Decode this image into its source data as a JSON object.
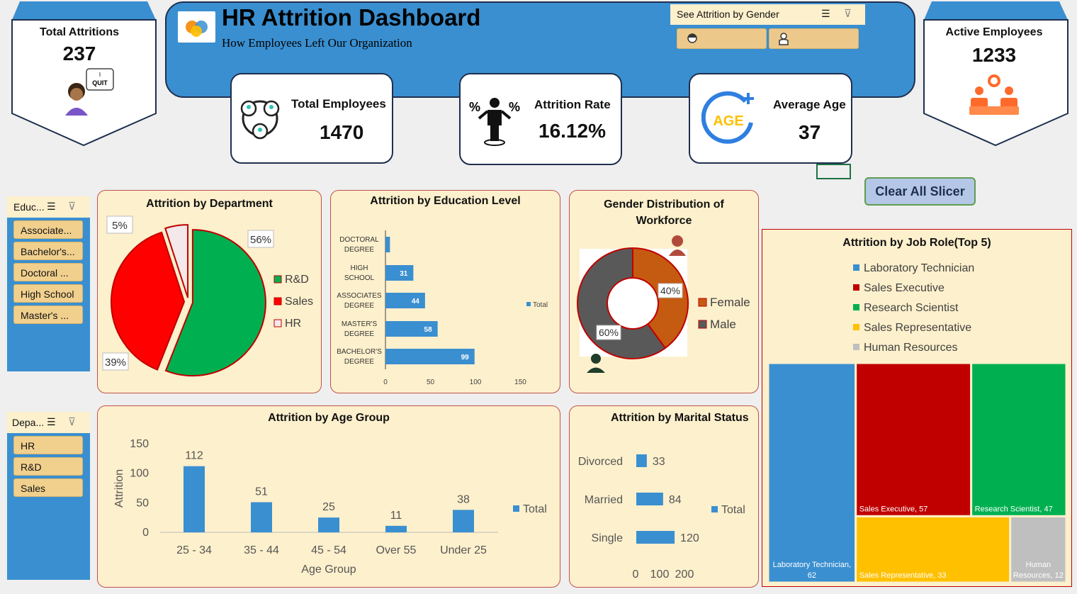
{
  "header": {
    "title": "HR Attrition Dashboard",
    "subtitle": "How Employees Left Our Organization"
  },
  "gender_slicer": {
    "title": "See Attrition by Gender",
    "items": [
      "female-icon",
      "male-icon"
    ]
  },
  "badges": {
    "left": {
      "label": "Total Attritions",
      "value": "237",
      "bubble": "I QUIT"
    },
    "right": {
      "label": "Active Employees",
      "value": "1233"
    }
  },
  "kpis": [
    {
      "label": "Total Employees",
      "value": "1470",
      "icon": "network-people-icon"
    },
    {
      "label": "Attrition Rate",
      "value": "16.12%",
      "icon": "person-percent-icon"
    },
    {
      "label": "Average Age",
      "value": "37",
      "icon": "age-icon",
      "icon_text": "AGE"
    }
  ],
  "clear_button": "Clear All Slicer",
  "slicers": {
    "education": {
      "title": "Educ...",
      "items": [
        "Associate...",
        "Bachelor's...",
        "Doctoral ...",
        "High School",
        "Master's ..."
      ]
    },
    "department": {
      "title": "Depa...",
      "items": [
        "HR",
        "R&D",
        "Sales"
      ]
    }
  },
  "colors": {
    "accent": "#3a8fd0",
    "card_bg": "#fdf0cc",
    "card_border": "#c0504d",
    "slicer_item": "#f1d08e"
  },
  "chart_data": [
    {
      "type": "pie",
      "title": "Attrition by Department",
      "categories": [
        "R&D",
        "Sales",
        "HR"
      ],
      "values": [
        56,
        39,
        5
      ],
      "labels": [
        "56%",
        "39%",
        "5%"
      ],
      "colors": [
        "#00b050",
        "#ff0000",
        "#f3e8ea"
      ],
      "legend": "right"
    },
    {
      "type": "bar",
      "orientation": "horizontal",
      "title": "Attrition by Education Level",
      "categories": [
        "DOCTORAL DEGREE",
        "HIGH SCHOOL",
        "ASSOCIATES DEGREE",
        "MASTER'S DEGREE",
        "BACHELOR'S DEGREE"
      ],
      "series": [
        {
          "name": "Total",
          "values": [
            5,
            31,
            44,
            58,
            99
          ]
        }
      ],
      "data_labels": [
        "",
        "31",
        "44",
        "58",
        "99"
      ],
      "xticks": [
        "0",
        "50",
        "100",
        "150"
      ],
      "xlim": [
        0,
        150
      ],
      "legend": "right"
    },
    {
      "type": "pie",
      "variant": "donut",
      "title": "Gender Distribution of Workforce",
      "categories": [
        "Female",
        "Male"
      ],
      "values": [
        40,
        60
      ],
      "labels": [
        "40%",
        "60%"
      ],
      "colors": [
        "#c55a11",
        "#595959"
      ],
      "legend": "right"
    },
    {
      "type": "bar",
      "title": "Attrition by Age Group",
      "categories": [
        "25 - 34",
        "35 - 44",
        "45 - 54",
        "Over 55",
        "Under 25"
      ],
      "series": [
        {
          "name": "Total",
          "values": [
            112,
            51,
            25,
            11,
            38
          ]
        }
      ],
      "xlabel": "Age Group",
      "ylabel": "Attrition",
      "yticks": [
        "0",
        "50",
        "100",
        "150"
      ],
      "ylim": [
        0,
        150
      ],
      "legend": "right"
    },
    {
      "type": "bar",
      "orientation": "horizontal",
      "title": "Attrition by Marital Status",
      "categories": [
        "Divorced",
        "Married",
        "Single"
      ],
      "series": [
        {
          "name": "Total",
          "values": [
            33,
            84,
            120
          ]
        }
      ],
      "xticks": [
        "0",
        "100",
        "200"
      ],
      "xlim": [
        0,
        200
      ],
      "legend": "right"
    },
    {
      "type": "treemap",
      "title": "Attrition by Job Role(Top 5)",
      "categories": [
        "Laboratory Technician",
        "Sales Executive",
        "Research Scientist",
        "Sales Representative",
        "Human Resources"
      ],
      "values": [
        62,
        57,
        47,
        33,
        12
      ],
      "colors": [
        "#3a8fd0",
        "#c00000",
        "#00b050",
        "#ffc000",
        "#bfbfbf"
      ],
      "legend": "top"
    }
  ]
}
